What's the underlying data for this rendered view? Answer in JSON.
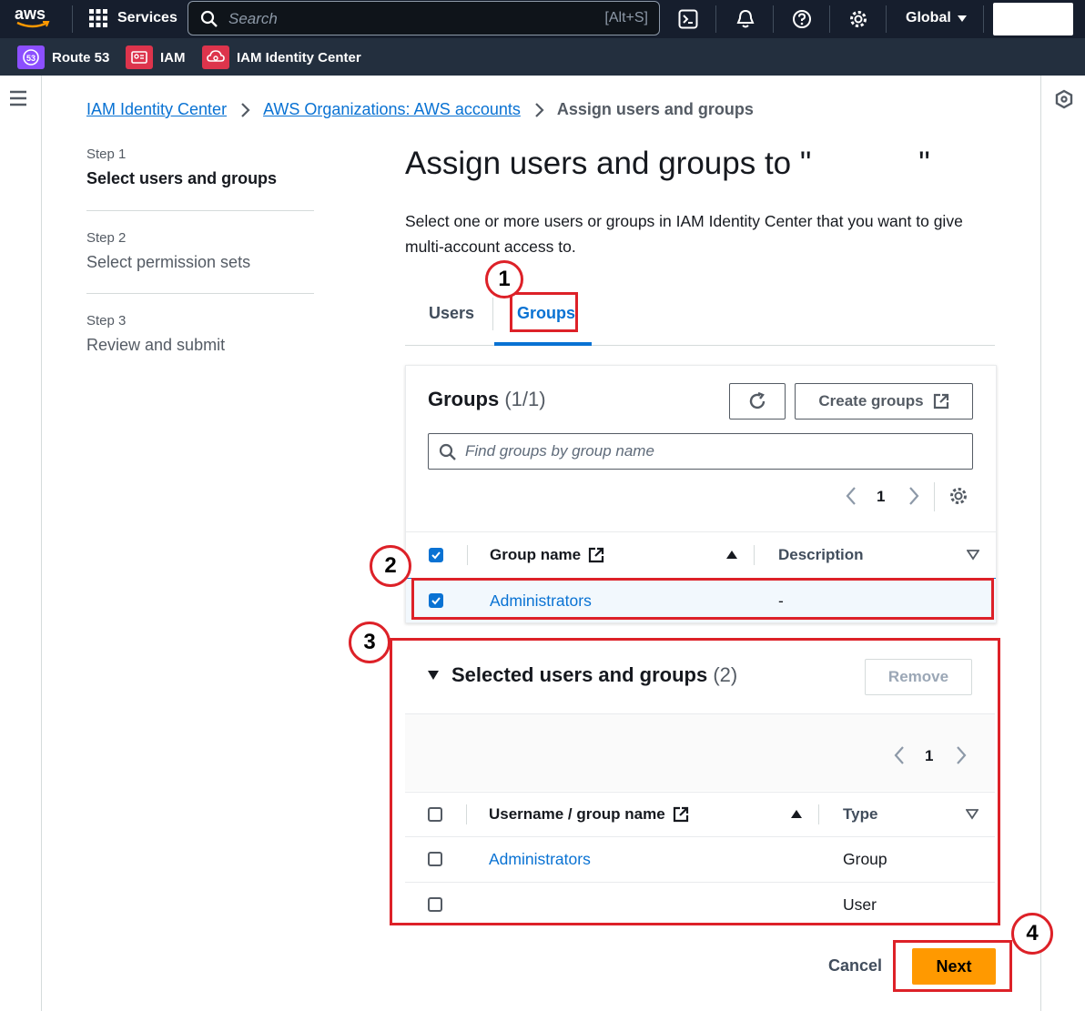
{
  "topbar": {
    "logo": "aws",
    "services_label": "Services",
    "search_placeholder": "Search",
    "search_shortcut": "[Alt+S]",
    "region": "Global",
    "icons": [
      "cloudshell-icon",
      "bell-icon",
      "help-icon",
      "gear-icon"
    ]
  },
  "favorites": [
    {
      "label": "Route 53",
      "icon": "route53-icon",
      "color": "#8c4fff"
    },
    {
      "label": "IAM",
      "icon": "iam-icon",
      "color": "#dd344c"
    },
    {
      "label": "IAM Identity Center",
      "icon": "identity-center-icon",
      "color": "#dd344c"
    }
  ],
  "breadcrumb": {
    "items": [
      "IAM Identity Center",
      "AWS Organizations: AWS accounts"
    ],
    "current": "Assign users and groups"
  },
  "steps": [
    {
      "label": "Step 1",
      "title": "Select users and groups"
    },
    {
      "label": "Step 2",
      "title": "Select permission sets"
    },
    {
      "label": "Step 3",
      "title": "Review and submit"
    }
  ],
  "page": {
    "title_prefix": "Assign users and groups to \"",
    "title_suffix": "\"",
    "description": "Select one or more users or groups in IAM Identity Center that you want to give multi-account access to."
  },
  "tabs": [
    "Users",
    "Groups"
  ],
  "groups_panel": {
    "title": "Groups",
    "count": "(1/1)",
    "create_label": "Create groups",
    "search_placeholder": "Find groups by group name",
    "page": "1",
    "columns": [
      "Group name",
      "Description"
    ],
    "rows": [
      {
        "name": "Administrators",
        "description": "-"
      }
    ]
  },
  "selected_panel": {
    "title": "Selected users and groups",
    "count": "(2)",
    "remove_label": "Remove",
    "page": "1",
    "columns": [
      "Username / group name",
      "Type"
    ],
    "rows": [
      {
        "name": "Administrators",
        "type": "Group"
      },
      {
        "name": "",
        "type": "User"
      }
    ]
  },
  "footer": {
    "cancel_label": "Cancel",
    "next_label": "Next"
  },
  "callouts": [
    "1",
    "2",
    "3",
    "4"
  ],
  "colors": {
    "accent": "#0972d3",
    "primary": "#ff9900",
    "highlight": "#dd2128",
    "nav_bg": "#161e2d"
  }
}
